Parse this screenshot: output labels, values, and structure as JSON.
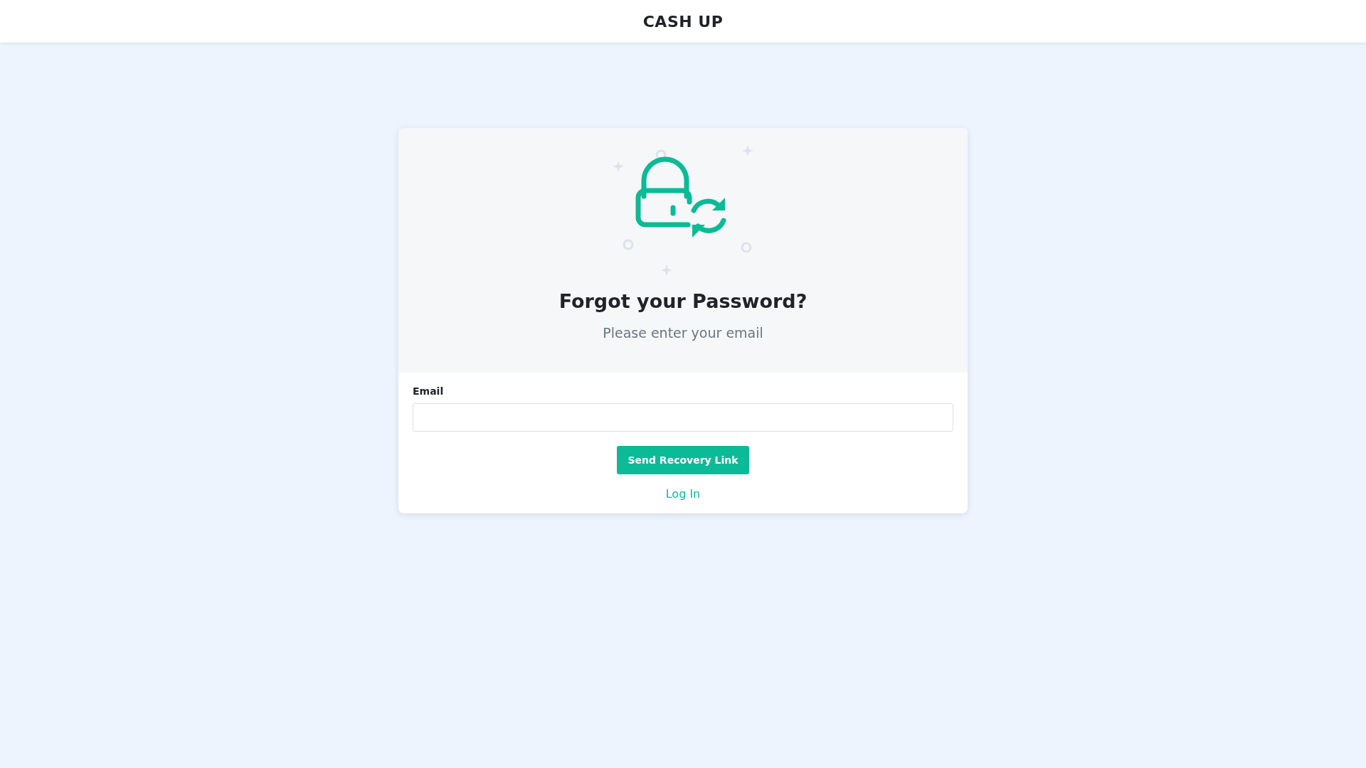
{
  "header": {
    "title": "CASH UP"
  },
  "card": {
    "title": "Forgot your Password?",
    "subtitle": "Please enter your email",
    "email": {
      "label": "Email"
    },
    "submit": "Send Recovery Link",
    "login_link": "Log In"
  }
}
